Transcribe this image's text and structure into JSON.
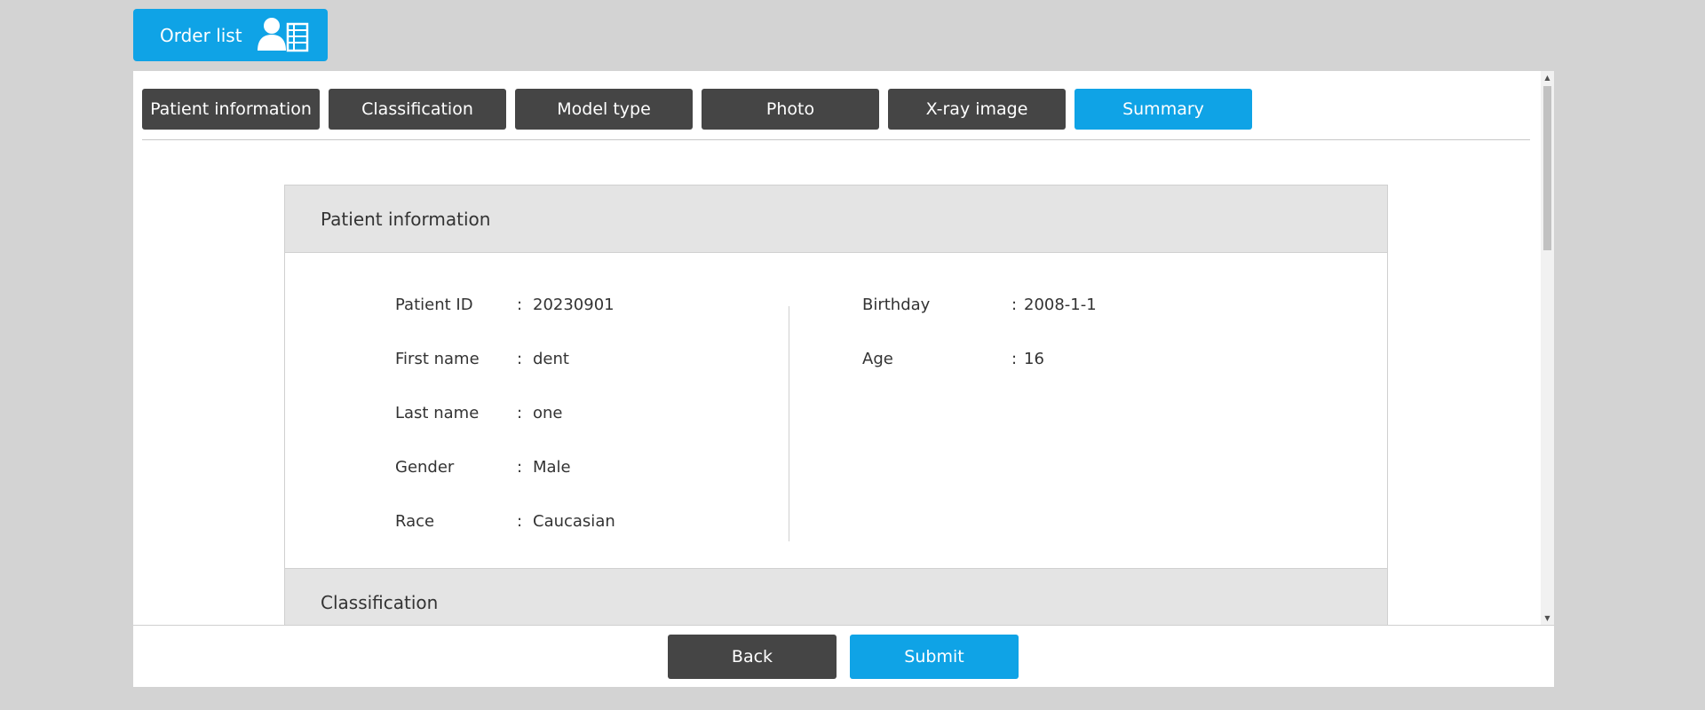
{
  "header": {
    "order_list_label": "Order list",
    "order_list_icon": "user-list-icon"
  },
  "tabs": [
    {
      "label": "Patient information",
      "active": false
    },
    {
      "label": "Classification",
      "active": false
    },
    {
      "label": "Model type",
      "active": false
    },
    {
      "label": "Photo",
      "active": false
    },
    {
      "label": "X-ray image",
      "active": false
    },
    {
      "label": "Summary",
      "active": true
    }
  ],
  "patient_section": {
    "title": "Patient information",
    "colon": ":",
    "left_fields": [
      {
        "label": "Patient ID",
        "value": "20230901"
      },
      {
        "label": "First name",
        "value": "dent"
      },
      {
        "label": "Last name",
        "value": "one"
      },
      {
        "label": "Gender",
        "value": "Male"
      },
      {
        "label": "Race",
        "value": "Caucasian"
      }
    ],
    "right_fields": [
      {
        "label": "Birthday",
        "value": "2008-1-1"
      },
      {
        "label": "Age",
        "value": "16"
      }
    ]
  },
  "classification_section": {
    "title": "Classification"
  },
  "footer": {
    "back_label": "Back",
    "submit_label": "Submit"
  },
  "colors": {
    "accent": "#0fa3e6",
    "dark_button": "#454545",
    "background": "#d3d3d3"
  }
}
